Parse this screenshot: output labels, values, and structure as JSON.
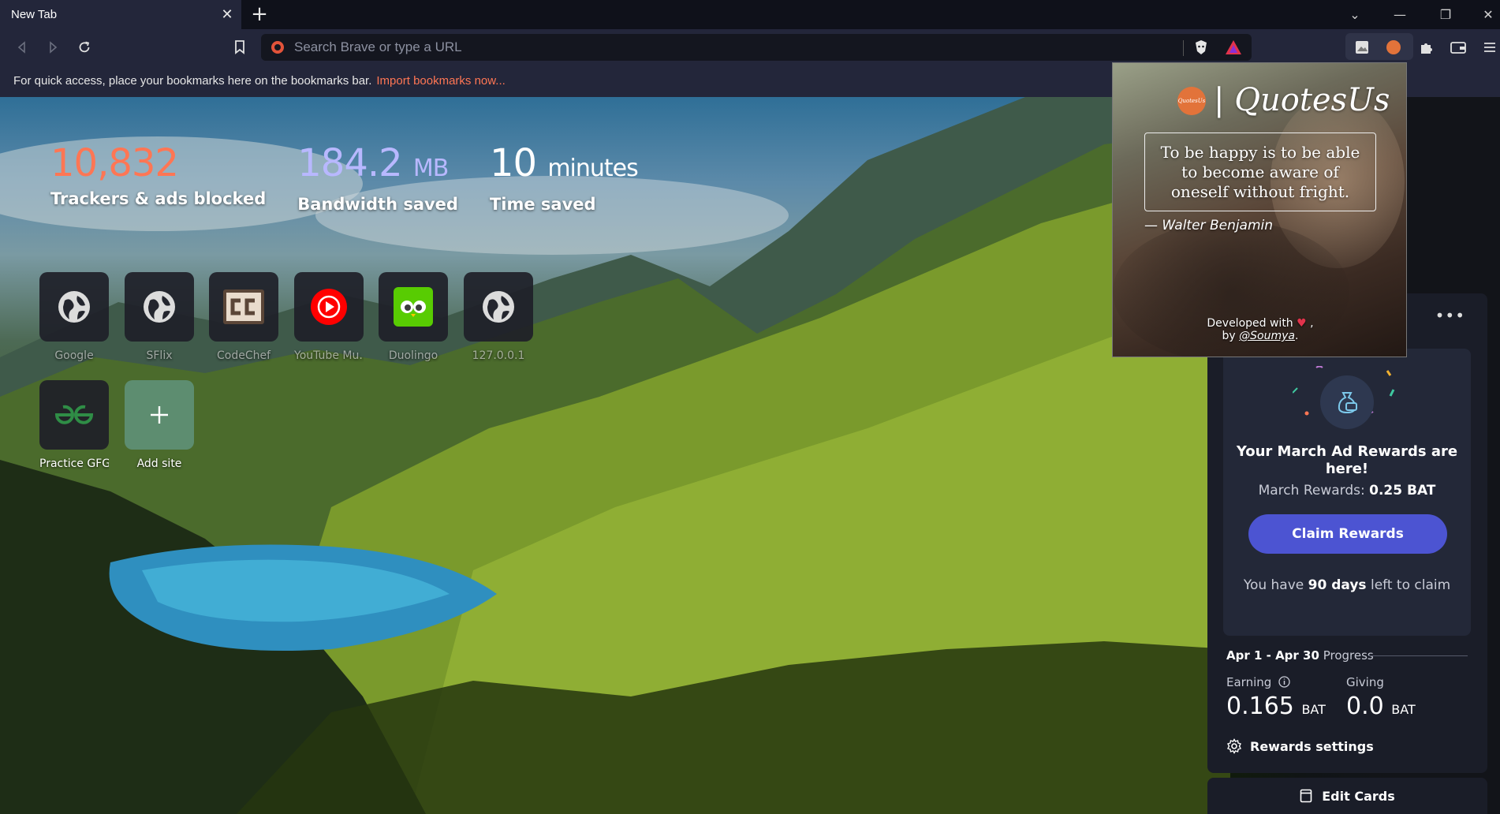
{
  "tab": {
    "title": "New Tab",
    "close_glyph": "✕",
    "new_tab_glyph": "+"
  },
  "window_controls": {
    "dropdown": "⌄",
    "minimize": "—",
    "restore": "❐",
    "close": "✕"
  },
  "address_bar": {
    "placeholder": "Search Brave or type a URL",
    "value": ""
  },
  "bookmarks_bar": {
    "message": "For quick access, place your bookmarks here on the bookmarks bar.",
    "import_link": "Import bookmarks now..."
  },
  "stats": [
    {
      "value": "10,832",
      "unit": "",
      "label": "Trackers & ads blocked",
      "color": "#ff7654"
    },
    {
      "value": "184.2",
      "unit": "MB",
      "label": "Bandwidth saved",
      "color": "#b8b8ff"
    },
    {
      "value": "10",
      "unit": "minutes",
      "label": "Time saved",
      "color": "#ffffff"
    }
  ],
  "top_sites": [
    {
      "label": "Google",
      "icon": "globe-icon"
    },
    {
      "label": "SFlix",
      "icon": "globe-icon"
    },
    {
      "label": "CodeChef",
      "icon": "codechef-icon"
    },
    {
      "label": "YouTube Mu...",
      "icon": "youtube-music-icon"
    },
    {
      "label": "Duolingo",
      "icon": "duolingo-icon"
    },
    {
      "label": "127.0.0.1",
      "icon": "globe-icon"
    },
    {
      "label": "Practice GFG",
      "icon": "gfg-icon"
    },
    {
      "label": "Add site",
      "icon": "plus-icon"
    }
  ],
  "popup": {
    "logo_text": "QuotesUs",
    "title": "| QuotesUs",
    "quote": "To be happy is to be able to become aware of oneself without fright.",
    "author": "—  Walter Benjamin",
    "developed_with": "Developed with",
    "heart": "♥",
    "by": "by",
    "author_handle": "@Soumya"
  },
  "rewards": {
    "menu": "•••",
    "heading": "Your March Ad Rewards are here!",
    "amount_prefix": "March Rewards:",
    "amount": "0.25 BAT",
    "claim_button": "Claim Rewards",
    "days_prefix": "You have",
    "days": "90 days",
    "days_suffix": "left to claim",
    "period": "Apr 1 - Apr 30",
    "period_suffix": "Progress",
    "earning_label": "Earning",
    "earning_value": "0.165",
    "earning_unit": "BAT",
    "giving_label": "Giving",
    "giving_value": "0.0",
    "giving_unit": "BAT",
    "settings": "Rewards settings"
  },
  "edit_cards": "Edit Cards"
}
